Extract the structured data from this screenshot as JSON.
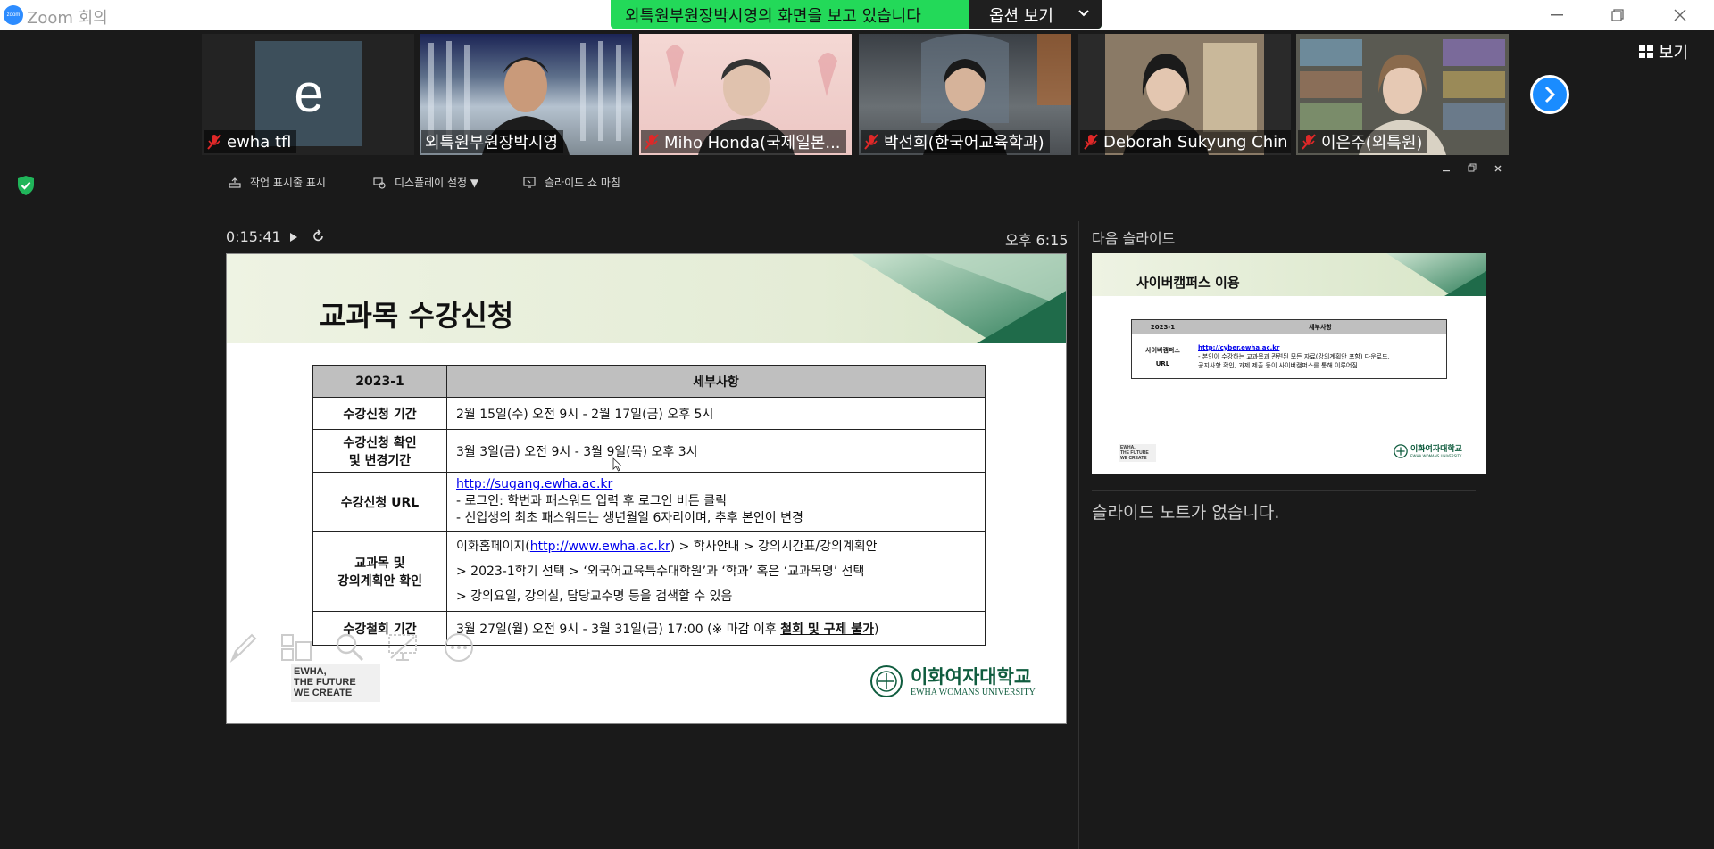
{
  "titlebar": {
    "logo": "zoom",
    "title": "Zoom 회의",
    "share_banner": "외특원부원장박시영의 화면을 보고 있습니다",
    "options_label": "옵션 보기"
  },
  "participants": [
    {
      "name": "ewha tfl",
      "initial": "e",
      "muted": true
    },
    {
      "name": "외특원부원장박시영",
      "muted": false,
      "active": true
    },
    {
      "name": "Miho Honda(국제일본...",
      "muted": true
    },
    {
      "name": "박선희(한국어교육학과)",
      "muted": true
    },
    {
      "name": "Deborah Sukyung Chin",
      "muted": true
    },
    {
      "name": "이은주(외특원)",
      "muted": true
    }
  ],
  "view_label": "보기",
  "presenter": {
    "toolbar": {
      "taskbar": "작업 표시줄 표시",
      "display": "디스플레이 설정 ▼",
      "end_show": "슬라이드 쇼 마침"
    },
    "timer": "0:15:41",
    "clock": "오후 6:15",
    "next_slide_label": "다음 슬라이드",
    "notes": "슬라이드 노트가 없습니다."
  },
  "slide": {
    "title": "교과목 수강신청",
    "header_col1": "2023-1",
    "header_col2": "세부사항",
    "rows": [
      {
        "label": "수강신청 기간",
        "lines": [
          "2월 15일(수) 오전 9시 - 2월 17일(금) 오후 5시"
        ]
      },
      {
        "label_line1": "수강신청 확인",
        "label_line2": "및 변경기간",
        "lines": [
          "3월 3일(금) 오전 9시 - 3월 9일(목) 오후 3시"
        ]
      },
      {
        "label": "수강신청 URL",
        "link": "http://sugang.ewha.ac.kr",
        "lines": [
          "- 로그인: 학번과 패스워드 입력 후 로그인 버튼 클릭",
          "- 신입생의 최초 패스워드는 생년월일 6자리이며, 추후 본인이 변경"
        ]
      },
      {
        "label_line1": "교과목 및",
        "label_line2": "강의계획안 확인",
        "line1_pre": "이화홈페이지(",
        "line1_link": "http://www.ewha.ac.kr",
        "line1_post": ") > 학사안내 > 강의시간표/강의계획안",
        "line2": "> 2023-1학기 선택 > ‘외국어교육특수대학원’과 ‘학과’ 혹은 ‘교과목명’ 선택",
        "line3": "> 강의요일, 강의실, 담당교수명 등을 검색할 수 있음"
      },
      {
        "label": "수강철회 기간",
        "pre": "3월 27일(월) 오전 9시 - 3월 31일(금) 17:00 (※ 마감 이후 ",
        "emph": "철회 및 구제 불가",
        "post": ")"
      }
    ],
    "logo_left": [
      "EWHA,",
      "THE FUTURE",
      "WE CREATE"
    ],
    "logo_right_kr": "이화여자대학교",
    "logo_right_en": "EWHA WOMANS UNIVERSITY"
  },
  "next_slide": {
    "title": "사이버캠퍼스 이용",
    "header_col1": "2023-1",
    "header_col2": "세부사항",
    "label_line1": "사이버캠퍼스",
    "label_line2": "URL",
    "link": "http://cyber.ewha.ac.kr",
    "line1": "- 본인이 수강하는 교과목과 관련된 모든 자료(강의계획안 포함) 다운로드,",
    "line2": "공지사항 확인, 과제 제출 등이 사이버캠퍼스를 통해 이루어짐",
    "logo_left": [
      "EWHA,",
      "THE FUTURE",
      "WE CREATE"
    ],
    "logo_right_kr": "이화여자대학교",
    "logo_right_en": "EWHA WOMANS UNIVERSITY"
  },
  "colors": {
    "banner": "#23d959",
    "accent": "#1a8cff",
    "active_tile": "#9ad84a",
    "ewha_green": "#0f5c3e"
  }
}
